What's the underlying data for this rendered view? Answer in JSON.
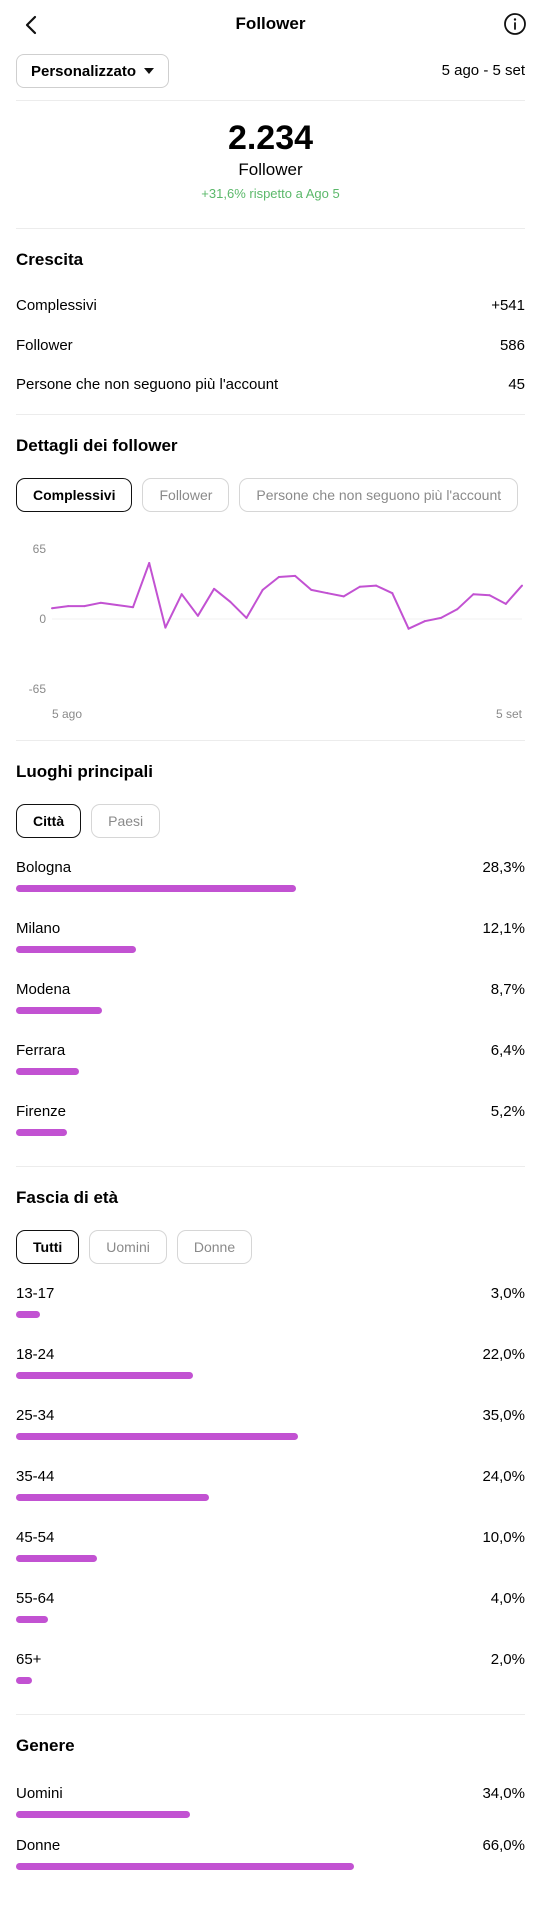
{
  "header": {
    "title": "Follower",
    "back_icon": "chevron-left-icon",
    "info_icon": "info-icon"
  },
  "filter": {
    "dropdown_label": "Personalizzato",
    "date_range": "5 ago - 5 set"
  },
  "summary": {
    "total": "2.234",
    "label": "Follower",
    "delta": "+31,6% rispetto a Ago 5"
  },
  "growth": {
    "title": "Crescita",
    "rows": [
      {
        "label": "Complessivi",
        "value": "+541"
      },
      {
        "label": "Follower",
        "value": "586"
      },
      {
        "label": "Persone che non seguono più l'account",
        "value": "45"
      }
    ]
  },
  "details": {
    "title": "Dettagli dei follower",
    "tabs": [
      "Complessivi",
      "Follower",
      "Persone che non seguono più l'account"
    ],
    "active_tab": 0
  },
  "chart_data": {
    "type": "line",
    "title": "",
    "y_ticks": [
      "65",
      "0",
      "-65"
    ],
    "ylim": [
      -65,
      65
    ],
    "x_tick_labels": [
      "5 ago",
      "5 set"
    ],
    "color": "#c252d2",
    "values": [
      10,
      12,
      12,
      15,
      13,
      11,
      52,
      -8,
      23,
      3,
      28,
      16,
      1,
      27,
      39,
      40,
      27,
      24,
      21,
      30,
      31,
      24,
      -9,
      -2,
      1,
      9,
      23,
      22,
      14,
      31
    ]
  },
  "locations": {
    "title": "Luoghi principali",
    "tabs": [
      "Città",
      "Paesi"
    ],
    "active_tab": 0,
    "rows": [
      {
        "label": "Bologna",
        "value": "28,3%",
        "fraction": 0.283
      },
      {
        "label": "Milano",
        "value": "12,1%",
        "fraction": 0.121
      },
      {
        "label": "Modena",
        "value": "8,7%",
        "fraction": 0.087
      },
      {
        "label": "Ferrara",
        "value": "6,4%",
        "fraction": 0.064
      },
      {
        "label": "Firenze",
        "value": "5,2%",
        "fraction": 0.052
      }
    ]
  },
  "age": {
    "title": "Fascia di età",
    "tabs": [
      "Tutti",
      "Uomini",
      "Donne"
    ],
    "active_tab": 0,
    "rows": [
      {
        "label": "13-17",
        "value": "3,0%",
        "fraction": 0.03
      },
      {
        "label": "18-24",
        "value": "22,0%",
        "fraction": 0.22
      },
      {
        "label": "25-34",
        "value": "35,0%",
        "fraction": 0.35
      },
      {
        "label": "35-44",
        "value": "24,0%",
        "fraction": 0.24
      },
      {
        "label": "45-54",
        "value": "10,0%",
        "fraction": 0.1
      },
      {
        "label": "55-64",
        "value": "4,0%",
        "fraction": 0.04
      },
      {
        "label": "65+",
        "value": "2,0%",
        "fraction": 0.02
      }
    ]
  },
  "gender": {
    "title": "Genere",
    "rows": [
      {
        "label": "Uomini",
        "value": "34,0%",
        "fraction": 0.34
      },
      {
        "label": "Donne",
        "value": "66,0%",
        "fraction": 0.66
      }
    ]
  }
}
